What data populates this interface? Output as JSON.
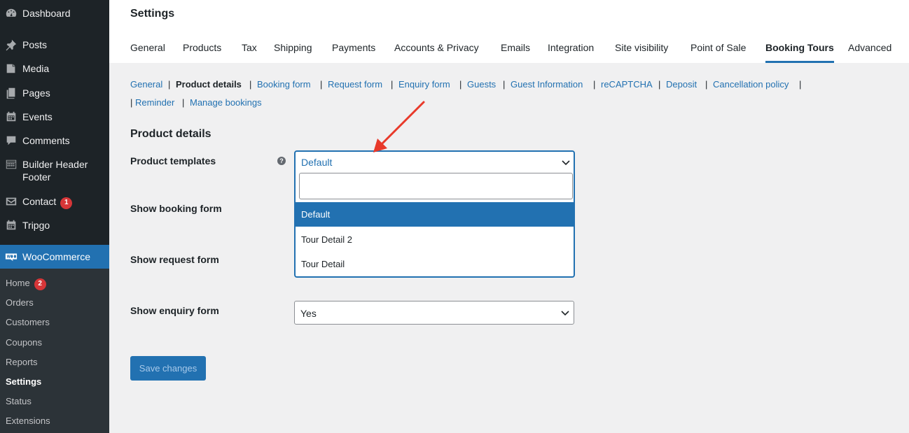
{
  "sidebar": {
    "items": [
      {
        "label": "Dashboard",
        "icon": "dashboard-icon"
      },
      {
        "label": "Posts",
        "icon": "pin-icon"
      },
      {
        "label": "Media",
        "icon": "media-icon"
      },
      {
        "label": "Pages",
        "icon": "pages-icon"
      },
      {
        "label": "Events",
        "icon": "calendar-icon"
      },
      {
        "label": "Comments",
        "icon": "comment-icon"
      },
      {
        "label": "Builder Header Footer",
        "icon": "grid-icon"
      },
      {
        "label": "Contact",
        "icon": "mail-icon",
        "badge": "1"
      },
      {
        "label": "Tripgo",
        "icon": "calendar-icon"
      },
      {
        "label": "WooCommerce",
        "icon": "woo-icon"
      }
    ],
    "submenu": [
      {
        "label": "Home",
        "badge": "2"
      },
      {
        "label": "Orders"
      },
      {
        "label": "Customers"
      },
      {
        "label": "Coupons"
      },
      {
        "label": "Reports"
      },
      {
        "label": "Settings"
      },
      {
        "label": "Status"
      },
      {
        "label": "Extensions"
      }
    ]
  },
  "header": {
    "title": "Settings",
    "tabs": [
      "General",
      "Products",
      "Tax",
      "Shipping",
      "Payments",
      "Accounts & Privacy",
      "Emails",
      "Integration",
      "Site visibility",
      "Point of Sale",
      "Booking Tours",
      "Advanced"
    ],
    "active_tab": "Booking Tours"
  },
  "subnav": {
    "items": [
      "General",
      "Product details",
      "Booking form",
      "Request form",
      "Enquiry form",
      "Guests",
      "Guest Information",
      "reCAPTCHA",
      "Deposit",
      "Cancellation policy",
      "Reminder",
      "Manage bookings"
    ],
    "separator": "|",
    "current": "Product details"
  },
  "section": {
    "heading": "Product details",
    "fields": {
      "product_templates": "Product templates",
      "show_booking_form": "Show booking form",
      "show_request_form": "Show request form",
      "show_enquiry_form": "Show enquiry form"
    },
    "help_icon": "?"
  },
  "dropdown": {
    "value": "Default",
    "search_value": "",
    "options": [
      "Default",
      "Tour Detail 2",
      "Tour Detail"
    ],
    "highlighted": "Default"
  },
  "enquiry_select": {
    "value": "Yes"
  },
  "save_button": "Save changes",
  "colors": {
    "sidebar_bg": "#1d2327",
    "submenu_bg": "#2c3338",
    "accent": "#2271b1",
    "badge": "#d63638",
    "annotation_arrow": "#e8392a"
  }
}
